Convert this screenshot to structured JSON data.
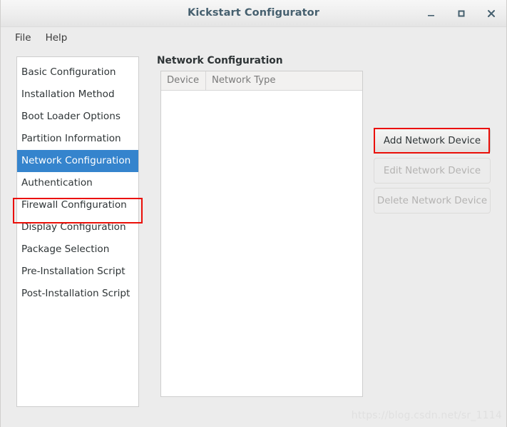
{
  "window": {
    "title": "Kickstart Configurator",
    "controls": [
      {
        "name": "minimize",
        "glyph": "_"
      },
      {
        "name": "maximize",
        "glyph": "□"
      },
      {
        "name": "close",
        "glyph": "✕"
      }
    ]
  },
  "menubar": {
    "items": [
      {
        "label": "File"
      },
      {
        "label": "Help"
      }
    ]
  },
  "sidebar": {
    "items": [
      {
        "label": "Basic Configuration",
        "selected": false
      },
      {
        "label": "Installation Method",
        "selected": false
      },
      {
        "label": "Boot Loader Options",
        "selected": false
      },
      {
        "label": "Partition Information",
        "selected": false
      },
      {
        "label": "Network Configuration",
        "selected": true
      },
      {
        "label": "Authentication",
        "selected": false
      },
      {
        "label": "Firewall Configuration",
        "selected": false
      },
      {
        "label": "Display Configuration",
        "selected": false
      },
      {
        "label": "Package Selection",
        "selected": false
      },
      {
        "label": "Pre-Installation Script",
        "selected": false
      },
      {
        "label": "Post-Installation Script",
        "selected": false
      }
    ]
  },
  "main": {
    "title": "Network Configuration",
    "table": {
      "columns": [
        "Device",
        "Network Type"
      ],
      "rows": []
    }
  },
  "actions": {
    "buttons": [
      {
        "label": "Add Network Device",
        "enabled": true,
        "highlighted": true
      },
      {
        "label": "Edit Network Device",
        "enabled": false,
        "highlighted": false
      },
      {
        "label": "Delete Network Device",
        "enabled": false,
        "highlighted": false
      }
    ]
  },
  "watermark": {
    "text": "https://blog.csdn.net/sr_1114"
  },
  "colors": {
    "selection_blue": "#3584cd",
    "annotation_red": "#ea0f08",
    "window_bg": "#ececec",
    "title_text": "#46606f"
  }
}
